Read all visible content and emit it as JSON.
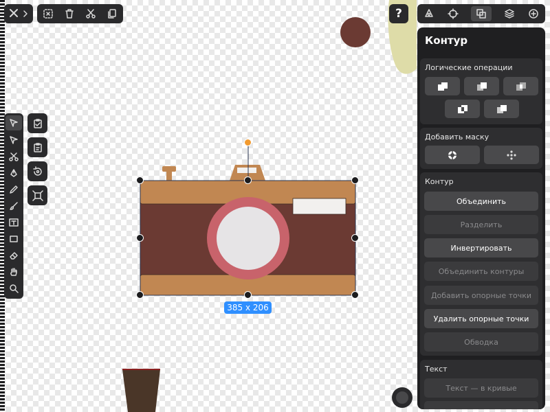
{
  "top_toolbar": {
    "items": [
      "close-icon",
      "chevron-right-icon",
      "select-clear-icon",
      "trash-icon",
      "scissors-icon",
      "copy-icon"
    ]
  },
  "top_right": {
    "help_label": "?",
    "tabs": [
      "pen-tool-icon",
      "transform-icon",
      "boolean-ops-icon",
      "layers-icon",
      "add-icon"
    ]
  },
  "panel": {
    "title": "Контур",
    "boolean": {
      "label": "Логические операции",
      "buttons": [
        "union-icon",
        "subtract-icon",
        "intersect-icon",
        "exclude-icon",
        "divide-icon"
      ]
    },
    "mask": {
      "label": "Добавить маску",
      "buttons": [
        "mask-icon",
        "mask-points-icon"
      ]
    },
    "path": {
      "label": "Контур",
      "buttons": [
        {
          "label": "Объединить",
          "enabled": true
        },
        {
          "label": "Разделить",
          "enabled": false
        },
        {
          "label": "Инвертировать",
          "enabled": true
        },
        {
          "label": "Объединить контуры",
          "enabled": false
        },
        {
          "label": "Добавить опорные точки",
          "enabled": false
        },
        {
          "label": "Удалить опорные точки",
          "enabled": true
        },
        {
          "label": "Обводка",
          "enabled": false
        }
      ]
    },
    "text": {
      "label": "Текст",
      "buttons": [
        {
          "label": "Текст — в кривые",
          "enabled": false
        }
      ]
    }
  },
  "left_tools": [
    "select-icon",
    "direct-select-icon",
    "scissors-icon",
    "pen-icon",
    "pencil-icon",
    "brush-icon",
    "text-icon",
    "rectangle-icon",
    "eraser-icon",
    "hand-icon",
    "zoom-icon"
  ],
  "side_tools": [
    "clipboard-check-icon",
    "paste-icon",
    "rotate-icon",
    "fit-icon"
  ],
  "canvas": {
    "size_label": "385 x 206",
    "colors": {
      "camera_body": "#6b3a33",
      "camera_band": "#c18752",
      "lens_ring": "#c8636b",
      "lens": "#e6e4e6",
      "brown_circle": "#6b3a33",
      "yellow_blob": "#dedca8",
      "cup": "#4a3628",
      "selection": "#1c1c1e",
      "badge": "#2f8fff"
    }
  }
}
